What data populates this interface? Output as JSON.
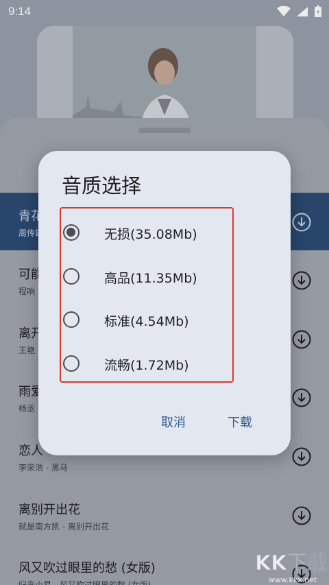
{
  "status_bar": {
    "time": "9:14"
  },
  "songs": [
    {
      "title": "青花",
      "subtitle": "周传雄"
    },
    {
      "title": "可能",
      "subtitle": "程响"
    },
    {
      "title": "离开",
      "subtitle": "王艳"
    },
    {
      "title": "雨爱",
      "subtitle": "杨丞"
    },
    {
      "title": "恋人",
      "subtitle": "李荣浩 - 黑马"
    },
    {
      "title": "离别开出花",
      "subtitle": "就是南方凯 - 离别开出花"
    },
    {
      "title": "风又吹过眼里的愁 (女版)",
      "subtitle": "归来小易 - 风又吹过眼里的愁 (女版)"
    }
  ],
  "dialog": {
    "title": "音质选择",
    "options": [
      {
        "label": "无损(35.08Mb)",
        "selected": true
      },
      {
        "label": "高品(11.35Mb)",
        "selected": false
      },
      {
        "label": "标准(4.54Mb)",
        "selected": false
      },
      {
        "label": "流畅(1.72Mb)",
        "selected": false
      }
    ],
    "cancel_label": "取消",
    "confirm_label": "下载"
  },
  "watermark": {
    "text": "KK下载",
    "url": "www.kkx.net"
  },
  "colors": {
    "accent": "#2f5d92",
    "highlight": "#d83a2e",
    "active_row": "#2b4a72"
  }
}
